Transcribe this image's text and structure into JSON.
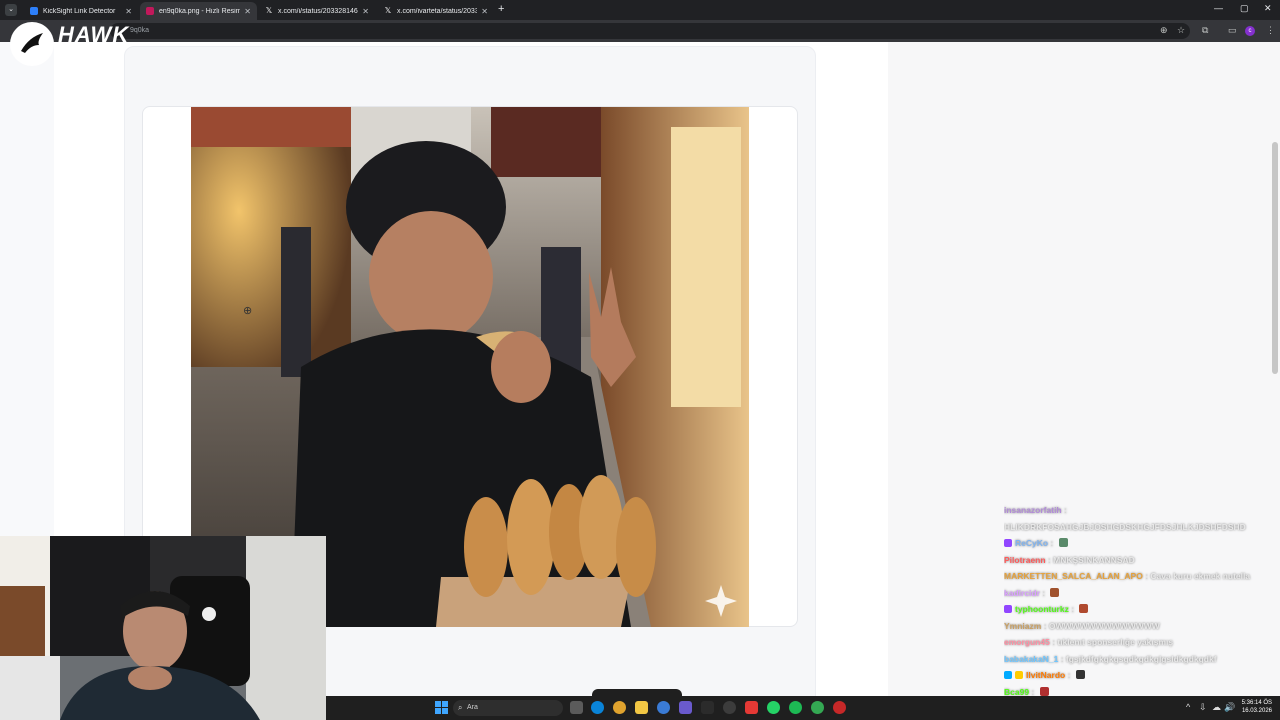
{
  "browser": {
    "menu_glyph": "⌄",
    "tabs": [
      {
        "title": "KickSight Link Detector",
        "active": false,
        "icon": "kicksight-icon",
        "color": "#2d7ff9"
      },
      {
        "title": "en9q0ka.png - Hızlı Resim",
        "active": true,
        "icon": "image-site-icon",
        "color": "#c2185b"
      },
      {
        "title": "x.com/i/status/2033281469574",
        "active": false,
        "icon": "x-icon",
        "color": "#ffffff"
      },
      {
        "title": "x.com/ivarteta/status/20335197",
        "active": false,
        "icon": "x-icon",
        "color": "#ffffff"
      }
    ],
    "close_glyph": "✕",
    "new_tab_glyph": "+",
    "window_controls": [
      "—",
      "▢",
      "✕"
    ],
    "address": "9q0ka",
    "profile_initial": "c"
  },
  "overlay": {
    "hawk_text": "HAWK"
  },
  "chat": {
    "messages": [
      {
        "user": "insanazorfatih",
        "user_color": "#b28bd9",
        "text": "HLIKDRKFOSAHGJBJOSHGDSKHGJFDSJHLKJDSHFDSHD",
        "badges": []
      },
      {
        "user": "ReCyKo",
        "user_color": "#7fb3f0",
        "text": "",
        "badges": [
          "#9146ff"
        ],
        "emotes": [
          "#5a8a6a"
        ]
      },
      {
        "user": "Pilotraenn",
        "user_color": "#ff5a5a",
        "text": "MNKŞSINKANNSAD",
        "badges": []
      },
      {
        "user": "MARKETTEN_SALCA_ALAN_APO",
        "user_color": "#e6a23c",
        "text": "Cava kuru ekmek nutella",
        "badges": []
      },
      {
        "user": "kadircidr",
        "user_color": "#d9a0ff",
        "text": "",
        "badges": [],
        "emotes": [
          "#a0522d"
        ]
      },
      {
        "user": "typhoonturkz",
        "user_color": "#53fc18",
        "text": "",
        "badges": [
          "#9146ff"
        ],
        "emotes": [
          "#b04a2f"
        ]
      },
      {
        "user": "Ymniazm",
        "user_color": "#c9a063",
        "text": "OWWWWWWWWWWWWW",
        "badges": []
      },
      {
        "user": "emorgun45",
        "user_color": "#ff8fa3",
        "text": "tıklenıt sponserlığe yakışmış",
        "badges": []
      },
      {
        "user": "babakakaN_1",
        "user_color": "#6ec6ff",
        "text": "fgsjkdfgkgkgsgdkgdkglgsldkgdkgdkf",
        "badges": []
      },
      {
        "user": "IlvitNardo",
        "user_color": "#ff7a00",
        "text": "",
        "badges": [
          "#00aaff",
          "#ffcc00"
        ],
        "emotes": [
          "#333333"
        ]
      },
      {
        "user": "Bca99",
        "user_color": "#53fc18",
        "text": "",
        "badges": [],
        "emotes": [
          "#b03030"
        ]
      }
    ]
  },
  "taskbar": {
    "search_placeholder": "Ara",
    "search_glyph": "⌕",
    "time": "5:36:14 ÖS",
    "date": "16.03.2026",
    "apps": [
      "file-explorer-icon",
      "edge-icon",
      "chrome-icon",
      "folder-icon",
      "ccleaner-icon",
      "kick-icon",
      "epic-icon",
      "obs-icon",
      "whatsapp-icon",
      "spotify-icon",
      "chrome-alt-icon",
      "steam-icon"
    ],
    "tray_glyphs": [
      "^",
      "⇩",
      "☁",
      "🔊"
    ]
  },
  "colors": {
    "tab_bg": "#202124",
    "active_tab": "#35363a",
    "kick_green": "#53fc18"
  }
}
